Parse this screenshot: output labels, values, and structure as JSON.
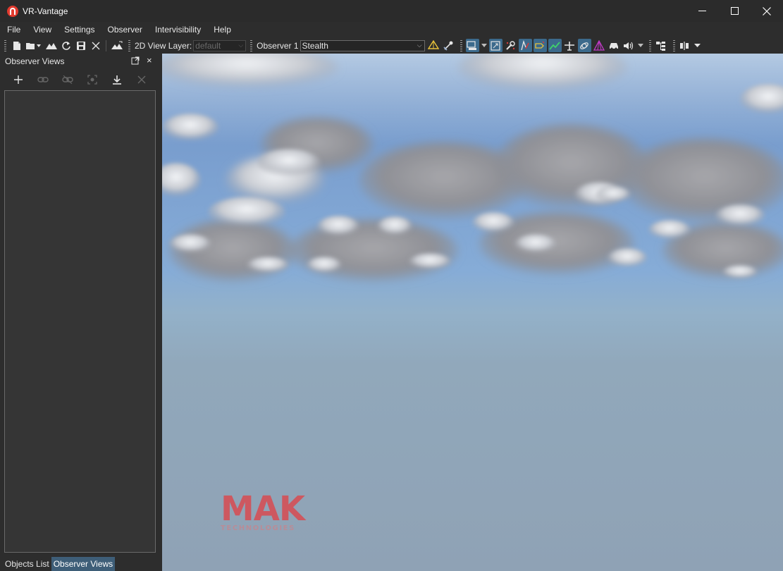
{
  "window": {
    "title": "VR-Vantage",
    "controls": [
      "minimize",
      "maximize",
      "close"
    ]
  },
  "menu": [
    "File",
    "View",
    "Settings",
    "Observer",
    "Intervisibility",
    "Help"
  ],
  "toolbar": {
    "view_layer_label": "2D View Layer:",
    "view_layer_value": "default",
    "observer_label": "Observer 1",
    "observer_mode": "Stealth"
  },
  "dock": {
    "title": "Observer Views",
    "tabs": [
      "Objects List",
      "Observer Views"
    ],
    "active_tab": "Observer Views",
    "tools": [
      "add-icon",
      "link-icon",
      "unlink-icon",
      "capture-icon",
      "download-icon",
      "delete-icon"
    ]
  },
  "viewport": {
    "logo_main": "MAK",
    "logo_sub": "TECHNOLOGIES"
  },
  "colors": {
    "accent": "#3e5e78",
    "active_tool": "#3c6a8c",
    "logo": "#cd5860",
    "app_logo": "#e23a2e"
  }
}
